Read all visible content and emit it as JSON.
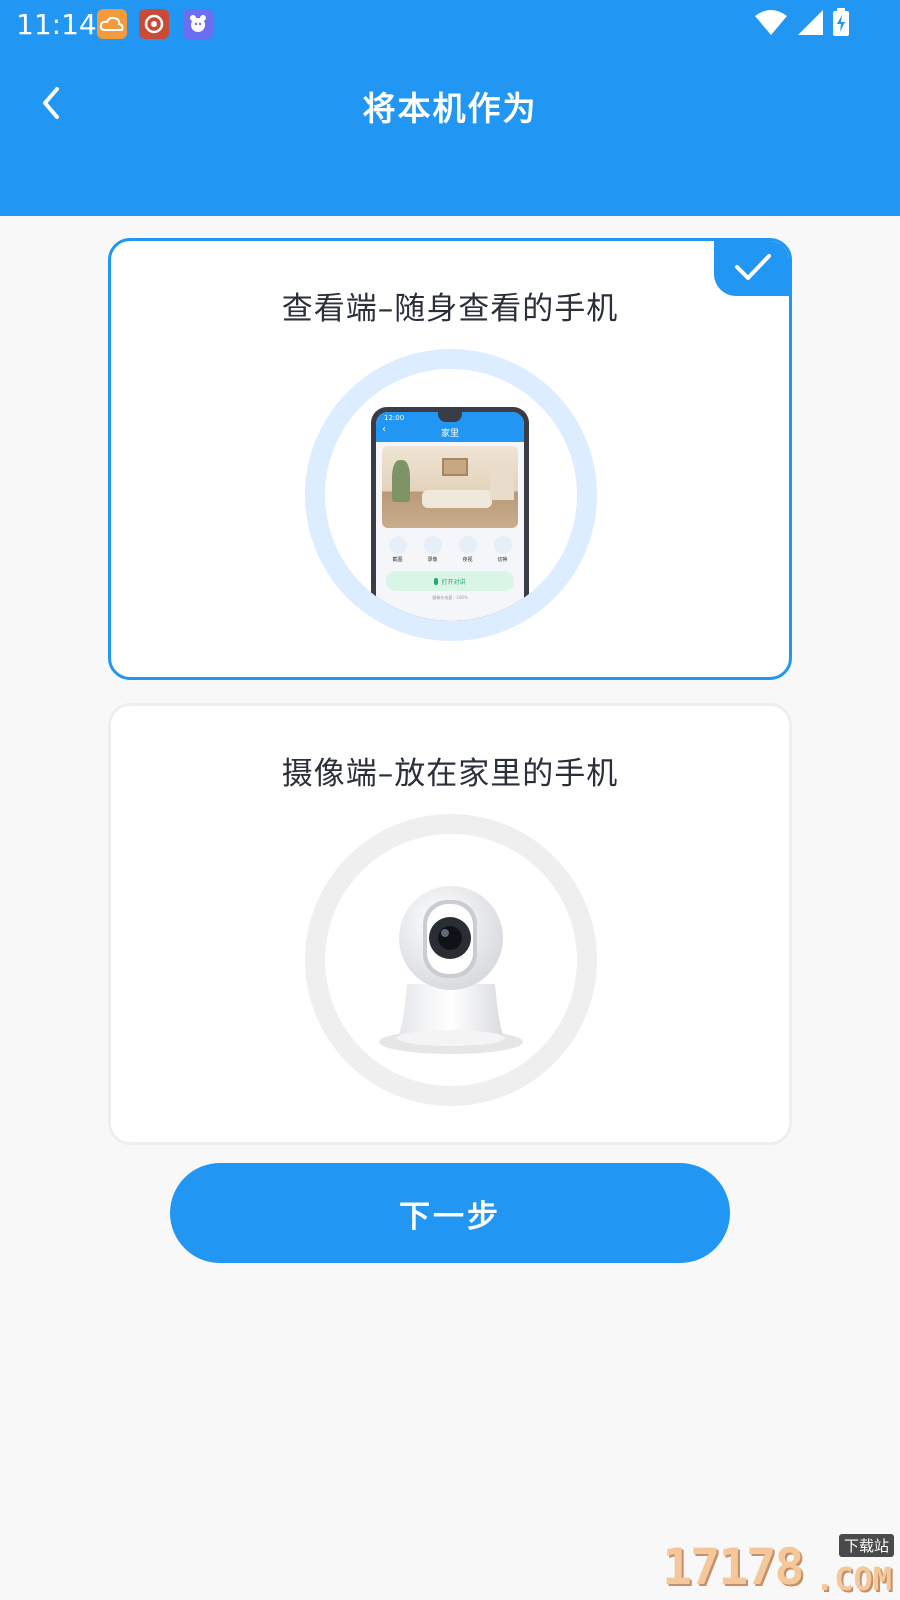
{
  "status_bar": {
    "time": "11:14",
    "notification_icons": [
      "weather-app-icon",
      "weibo-icon",
      "pet-app-icon"
    ],
    "indicators": [
      "wifi-icon",
      "signal-icon",
      "battery-charging-icon"
    ]
  },
  "header": {
    "title": "将本机作为",
    "back_icon": "chevron-left-icon",
    "color": "#2196f3"
  },
  "options": [
    {
      "title": "查看端–随身查看的手机",
      "selected": true,
      "illustration": "phone-viewer-illustration",
      "phone_screen": {
        "time": "12:00",
        "title": "家里",
        "actions": [
          "截图",
          "录像",
          "夜视",
          "切换"
        ],
        "talk_button": "打开对讲",
        "footer": "摄像头电量：100%"
      }
    },
    {
      "title": "摄像端–放在家里的手机",
      "selected": false,
      "illustration": "security-camera-illustration"
    }
  ],
  "next_button": {
    "label": "下一步"
  },
  "watermark": {
    "digits": "17178",
    "cn": "下载站",
    "suffix": ".COM"
  },
  "colors": {
    "accent": "#2196f3",
    "ring_selected": "#dcedff",
    "ring_unselected": "#efefef",
    "background": "#f8f8f8"
  }
}
